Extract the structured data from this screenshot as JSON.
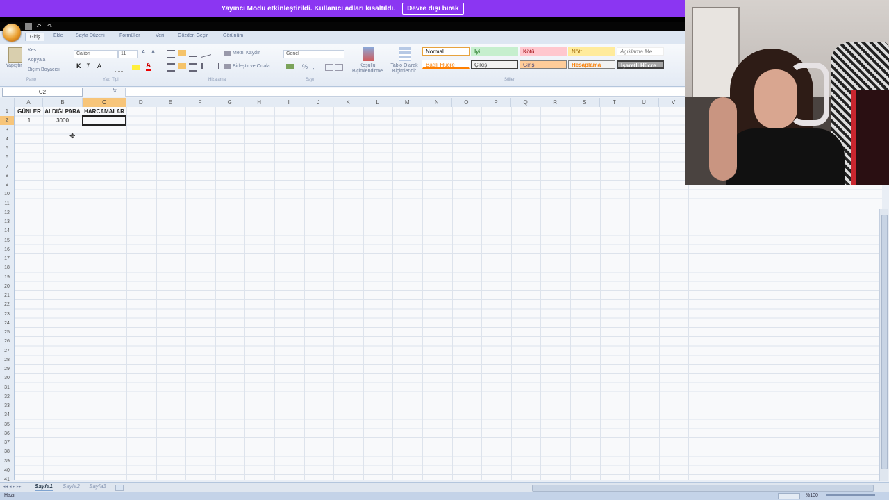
{
  "banner": {
    "message": "Yayıncı Modu etkinleştirildi. Kullanıcı adları kısaltıldı.",
    "button": "Devre dışı bırak"
  },
  "tabs": [
    "Giriş",
    "Ekle",
    "Sayfa Düzeni",
    "Formüller",
    "Veri",
    "Gözden Geçir",
    "Görünüm"
  ],
  "ribbon": {
    "paste": "Yapıştır",
    "cut": "Kes",
    "copy": "Kopyala",
    "format_painter": "Biçim Boyacısı",
    "font_name": "Calibri",
    "font_size": "11",
    "bold": "K",
    "italic": "T",
    "underline": "A",
    "wrap_text": "Metni Kaydır",
    "merge_center": "Birleştir ve Ortala",
    "number_format": "Genel",
    "conditional": "Koşullu Biçimlendirme",
    "as_table": "Tablo Olarak Biçimlendir",
    "groups": {
      "clipboard": "Pano",
      "font": "Yazı Tipi",
      "alignment": "Hizalama",
      "number": "Sayı",
      "styles": "Stiller"
    },
    "styles": {
      "normal": "Normal",
      "good": "İyi",
      "bad": "Kötü",
      "neutral": "Nötr",
      "explanatory": "Açıklama Me...",
      "linked": "Bağlı Hücre",
      "output": "Çıkış",
      "input": "Giriş",
      "calculation": "Hesaplama",
      "check": "İşaretli Hücre"
    },
    "style_colors": {
      "good": "#c6efce",
      "bad": "#ffc7ce",
      "neutral": "#ffeb9c",
      "input": "#ffcc99",
      "calculation": "#f2f2f2",
      "check": "#a5a5a5"
    }
  },
  "formula_bar": {
    "name_box": "C2",
    "fx": "fx",
    "content": ""
  },
  "columns": [
    "A",
    "B",
    "C",
    "D",
    "E",
    "F",
    "G",
    "H",
    "I",
    "J",
    "K",
    "L",
    "M",
    "N",
    "O",
    "P",
    "Q",
    "R",
    "S",
    "T",
    "U",
    "V"
  ],
  "rows": [
    "1",
    "2",
    "3",
    "4",
    "5",
    "6",
    "7",
    "8",
    "9",
    "10",
    "11",
    "12",
    "13",
    "14",
    "15",
    "16",
    "17",
    "18",
    "19",
    "20",
    "21",
    "22",
    "23",
    "24",
    "25",
    "26",
    "27",
    "28",
    "29",
    "30",
    "31",
    "32",
    "33",
    "34",
    "35",
    "36",
    "37",
    "38",
    "39",
    "40",
    "41"
  ],
  "cells": {
    "A1": "GÜNLER",
    "B1": "ALDIĞI PARA",
    "C1": "HARCAMALAR",
    "A2": "1",
    "B2": "3000"
  },
  "selected_cell": "C2",
  "sheets": [
    "Sayfa1",
    "Sayfa2",
    "Sayfa3"
  ],
  "status": {
    "ready": "Hazır",
    "zoom": "%100"
  }
}
